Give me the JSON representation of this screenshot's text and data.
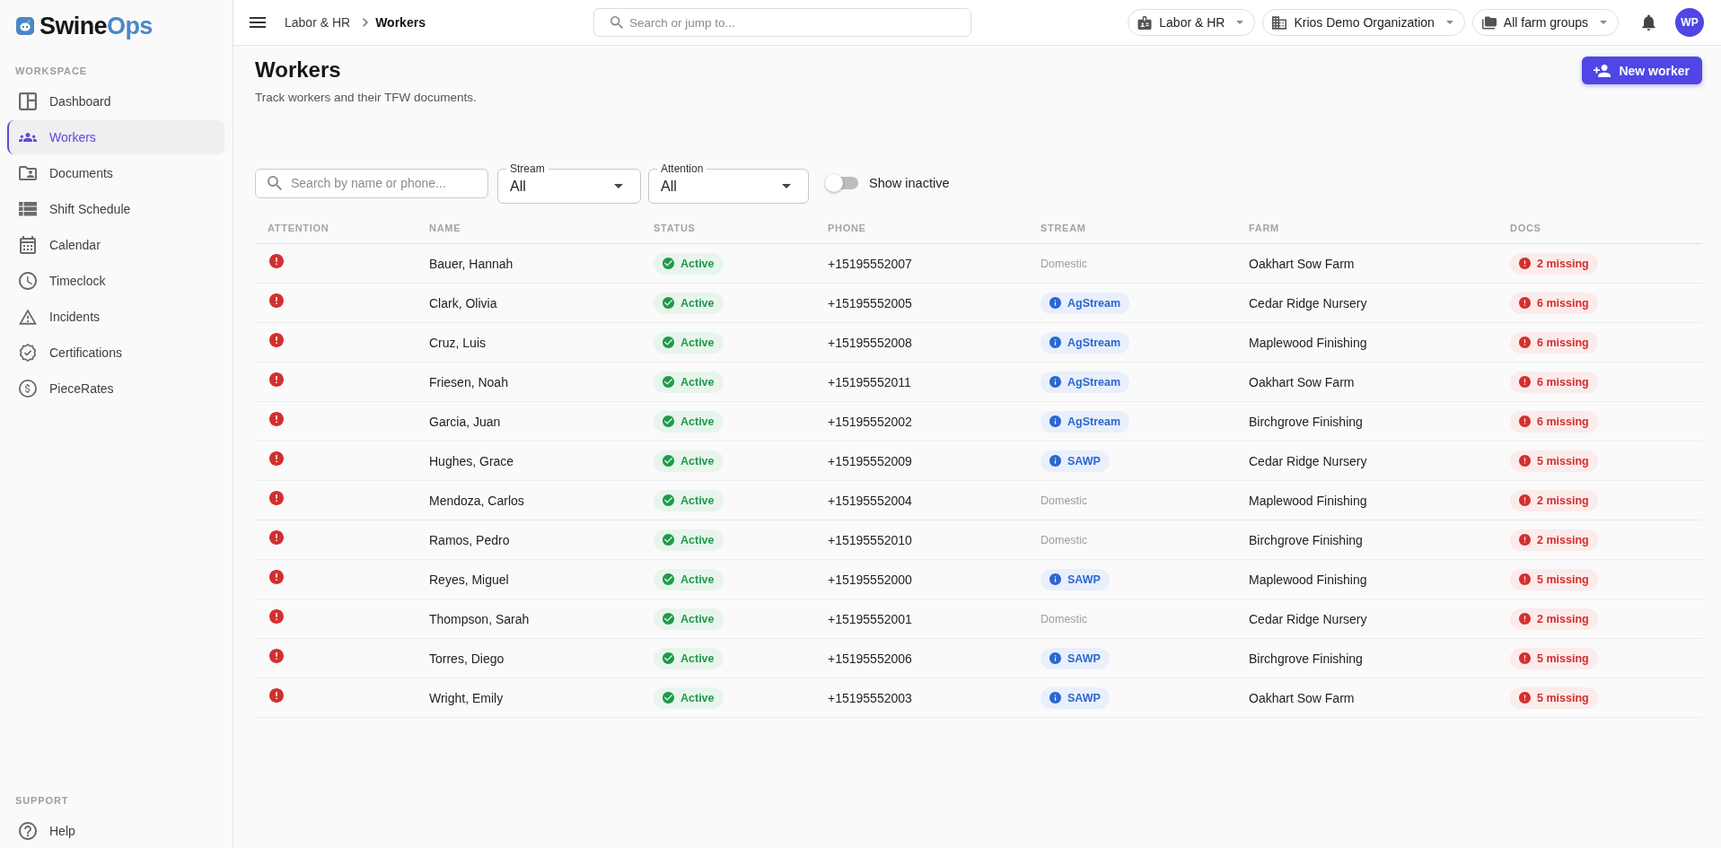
{
  "sidebar": {
    "brand": {
      "name": "Swine",
      "accent": "Ops"
    },
    "sections": [
      {
        "title": "WORKSPACE",
        "items": [
          {
            "label": "Dashboard",
            "selected": false
          },
          {
            "label": "Workers",
            "selected": true
          },
          {
            "label": "Documents",
            "selected": false
          },
          {
            "label": "Shift Schedule",
            "selected": false
          },
          {
            "label": "Calendar",
            "selected": false
          },
          {
            "label": "Timeclock",
            "selected": false
          },
          {
            "label": "Incidents",
            "selected": false
          },
          {
            "label": "Certifications",
            "selected": false
          },
          {
            "label": "PieceRates",
            "selected": false
          }
        ]
      },
      {
        "title": "SUPPORT",
        "items": [
          {
            "label": "Help",
            "selected": false
          }
        ]
      }
    ]
  },
  "topbar": {
    "breadcrumb": [
      {
        "label": "Labor & HR",
        "current": false
      },
      {
        "label": "Workers",
        "current": true
      }
    ],
    "search": {
      "placeholder": "Search or jump to..."
    },
    "selectors": [
      {
        "label": "Labor & HR"
      },
      {
        "label": "Krios Demo Organization"
      },
      {
        "label": "All farm groups"
      }
    ],
    "avatar": {
      "initials": "WP"
    }
  },
  "page": {
    "title": "Workers",
    "subtitle": "Track workers and their TFW documents.",
    "action": {
      "label": "New worker"
    }
  },
  "filters": {
    "search": {
      "placeholder": "Search by name or phone..."
    },
    "selects": [
      {
        "label": "Stream",
        "value": "All"
      },
      {
        "label": "Attention",
        "value": "All"
      }
    ],
    "toggle": {
      "label": "Show inactive",
      "on": false
    }
  },
  "table": {
    "columns": [
      "ATTENTION",
      "NAME",
      "STATUS",
      "PHONE",
      "STREAM",
      "FARM",
      "DOCS"
    ],
    "rows": [
      {
        "attention": true,
        "name": "Bauer, Hannah",
        "status": "Active",
        "phone": "+15195552007",
        "stream": {
          "label": "Domestic",
          "kind": "plain"
        },
        "farm": "Oakhart Sow Farm",
        "docs": "2 missing"
      },
      {
        "attention": true,
        "name": "Clark, Olivia",
        "status": "Active",
        "phone": "+15195552005",
        "stream": {
          "label": "AgStream",
          "kind": "chip"
        },
        "farm": "Cedar Ridge Nursery",
        "docs": "6 missing"
      },
      {
        "attention": true,
        "name": "Cruz, Luis",
        "status": "Active",
        "phone": "+15195552008",
        "stream": {
          "label": "AgStream",
          "kind": "chip"
        },
        "farm": "Maplewood Finishing",
        "docs": "6 missing"
      },
      {
        "attention": true,
        "name": "Friesen, Noah",
        "status": "Active",
        "phone": "+15195552011",
        "stream": {
          "label": "AgStream",
          "kind": "chip"
        },
        "farm": "Oakhart Sow Farm",
        "docs": "6 missing"
      },
      {
        "attention": true,
        "name": "Garcia, Juan",
        "status": "Active",
        "phone": "+15195552002",
        "stream": {
          "label": "AgStream",
          "kind": "chip"
        },
        "farm": "Birchgrove Finishing",
        "docs": "6 missing"
      },
      {
        "attention": true,
        "name": "Hughes, Grace",
        "status": "Active",
        "phone": "+15195552009",
        "stream": {
          "label": "SAWP",
          "kind": "chip"
        },
        "farm": "Cedar Ridge Nursery",
        "docs": "5 missing"
      },
      {
        "attention": true,
        "name": "Mendoza, Carlos",
        "status": "Active",
        "phone": "+15195552004",
        "stream": {
          "label": "Domestic",
          "kind": "plain"
        },
        "farm": "Maplewood Finishing",
        "docs": "2 missing"
      },
      {
        "attention": true,
        "name": "Ramos, Pedro",
        "status": "Active",
        "phone": "+15195552010",
        "stream": {
          "label": "Domestic",
          "kind": "plain"
        },
        "farm": "Birchgrove Finishing",
        "docs": "2 missing"
      },
      {
        "attention": true,
        "name": "Reyes, Miguel",
        "status": "Active",
        "phone": "+15195552000",
        "stream": {
          "label": "SAWP",
          "kind": "chip"
        },
        "farm": "Maplewood Finishing",
        "docs": "5 missing"
      },
      {
        "attention": true,
        "name": "Thompson, Sarah",
        "status": "Active",
        "phone": "+15195552001",
        "stream": {
          "label": "Domestic",
          "kind": "plain"
        },
        "farm": "Cedar Ridge Nursery",
        "docs": "2 missing"
      },
      {
        "attention": true,
        "name": "Torres, Diego",
        "status": "Active",
        "phone": "+15195552006",
        "stream": {
          "label": "SAWP",
          "kind": "chip"
        },
        "farm": "Birchgrove Finishing",
        "docs": "5 missing"
      },
      {
        "attention": true,
        "name": "Wright, Emily",
        "status": "Active",
        "phone": "+15195552003",
        "stream": {
          "label": "SAWP",
          "kind": "chip"
        },
        "farm": "Oakhart Sow Farm",
        "docs": "5 missing"
      }
    ]
  }
}
